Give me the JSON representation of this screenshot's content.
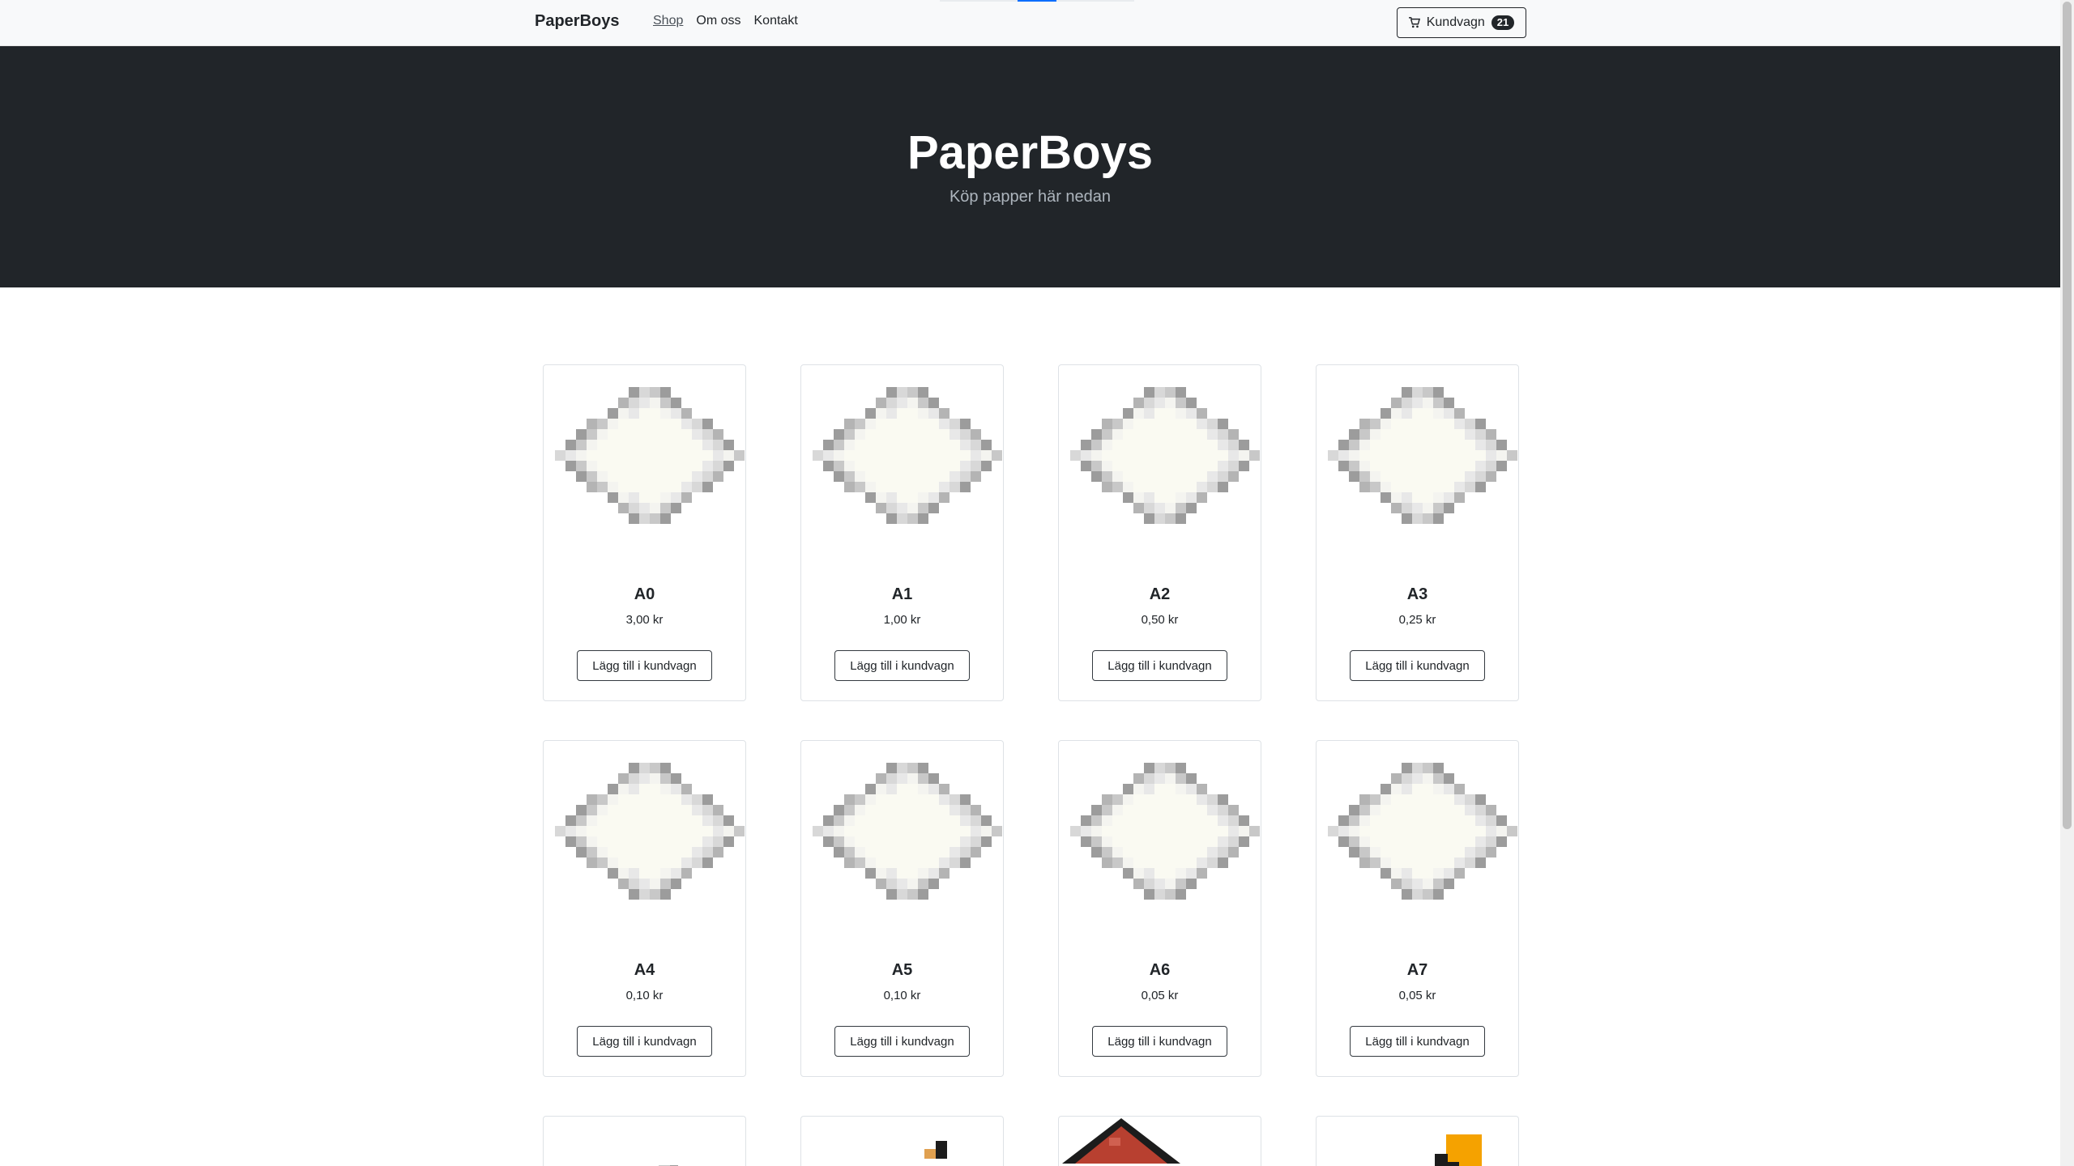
{
  "nav": {
    "brand": "PaperBoys",
    "links": [
      {
        "label": "Shop",
        "active": true
      },
      {
        "label": "Om oss",
        "active": false
      },
      {
        "label": "Kontakt",
        "active": false
      }
    ],
    "cart": {
      "label": "Kundvagn",
      "count": "21",
      "icon": "cart-icon"
    }
  },
  "hero": {
    "title": "PaperBoys",
    "subtitle": "Köp papper här nedan"
  },
  "products": [
    {
      "name": "A0",
      "price": "3,00 kr",
      "button": "Lägg till i kundvagn",
      "image": "paper-icon"
    },
    {
      "name": "A1",
      "price": "1,00 kr",
      "button": "Lägg till i kundvagn",
      "image": "paper-icon"
    },
    {
      "name": "A2",
      "price": "0,50 kr",
      "button": "Lägg till i kundvagn",
      "image": "paper-icon"
    },
    {
      "name": "A3",
      "price": "0,25 kr",
      "button": "Lägg till i kundvagn",
      "image": "paper-icon"
    },
    {
      "name": "A4",
      "price": "0,10 kr",
      "button": "Lägg till i kundvagn",
      "image": "paper-icon"
    },
    {
      "name": "A5",
      "price": "0,10 kr",
      "button": "Lägg till i kundvagn",
      "image": "paper-icon"
    },
    {
      "name": "A6",
      "price": "0,05 kr",
      "button": "Lägg till i kundvagn",
      "image": "paper-icon"
    },
    {
      "name": "A7",
      "price": "0,05 kr",
      "button": "Lägg till i kundvagn",
      "image": "paper-icon"
    }
  ],
  "partial_products": [
    {
      "image": "paper-icon"
    },
    {
      "image": "orange-item-icon"
    },
    {
      "image": "red-item-icon"
    },
    {
      "image": "gold-item-icon"
    }
  ],
  "colors": {
    "hero_bg": "#212529",
    "navbar_bg": "#f8f9fa",
    "paper_fill": "#fafaf2"
  }
}
